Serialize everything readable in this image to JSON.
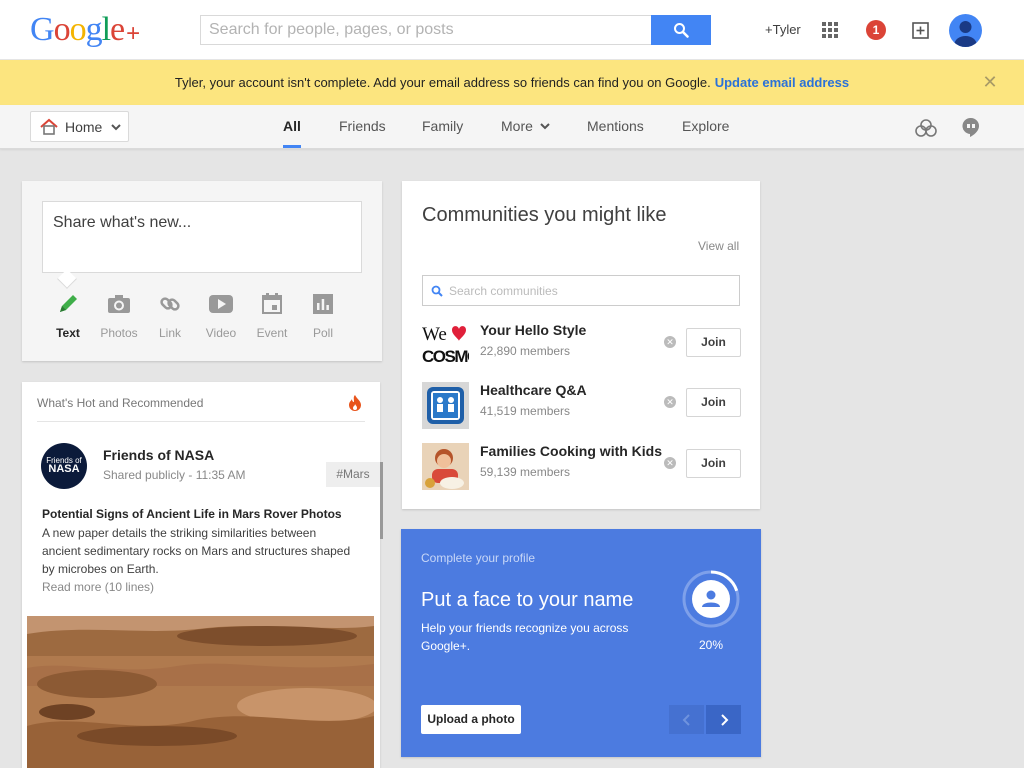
{
  "header": {
    "logo_letters": [
      "G",
      "o",
      "o",
      "g",
      "l",
      "e"
    ],
    "logo_plus": "+",
    "search_placeholder": "Search for people, pages, or posts",
    "profile_name": "+Tyler",
    "notification_count": "1"
  },
  "notice": {
    "message": "Tyler, your account isn't complete. Add your email address so friends can find you on Google.",
    "link": "Update email address",
    "close": "✕"
  },
  "nav": {
    "home_label": "Home",
    "tabs": [
      {
        "label": "All",
        "active": true
      },
      {
        "label": "Friends"
      },
      {
        "label": "Family"
      },
      {
        "label": "More"
      },
      {
        "label": "Mentions"
      },
      {
        "label": "Explore"
      }
    ]
  },
  "share": {
    "placeholder": "Share what's new...",
    "tools": [
      {
        "label": "Text",
        "icon": "pencil-icon"
      },
      {
        "label": "Photos",
        "icon": "camera-icon"
      },
      {
        "label": "Link",
        "icon": "link-icon"
      },
      {
        "label": "Video",
        "icon": "video-icon"
      },
      {
        "label": "Event",
        "icon": "event-icon"
      },
      {
        "label": "Poll",
        "icon": "poll-icon"
      }
    ]
  },
  "hot": {
    "title": "What's Hot and Recommended",
    "post": {
      "author": "Friends of NASA",
      "avatar_text_small": "Friends of",
      "avatar_text_big": "NASA",
      "meta": "Shared publicly  -  11:35 AM",
      "tag": "#Mars",
      "title": "Potential Signs of Ancient Life in Mars Rover Photos",
      "body": "A new paper details the striking similarities between ancient sedimentary rocks on Mars and structures shaped by microbes on Earth.",
      "read_more": "Read more (10 lines)"
    }
  },
  "communities": {
    "title": "Communities you might like",
    "view_all": "View all",
    "search_placeholder": "Search communities",
    "items": [
      {
        "name": "Your Hello Style",
        "members": "22,890 members",
        "join": "Join",
        "thumb_line1": "We",
        "thumb_line2": "COSMO"
      },
      {
        "name": "Healthcare Q&A",
        "members": "41,519 members",
        "join": "Join"
      },
      {
        "name": "Families Cooking with Kids",
        "members": "59,139 members",
        "join": "Join"
      }
    ]
  },
  "profile": {
    "subtitle": "Complete your profile",
    "title": "Put a face to your name",
    "description": "Help your friends recognize you across Google+.",
    "percent": "20%",
    "progress": 0.2,
    "upload_label": "Upload a photo"
  },
  "colors": {
    "brand_blue": "#4285f4",
    "notice_bg": "#fce57f",
    "profile_card": "#4c7be0",
    "notification_red": "#db4437"
  }
}
